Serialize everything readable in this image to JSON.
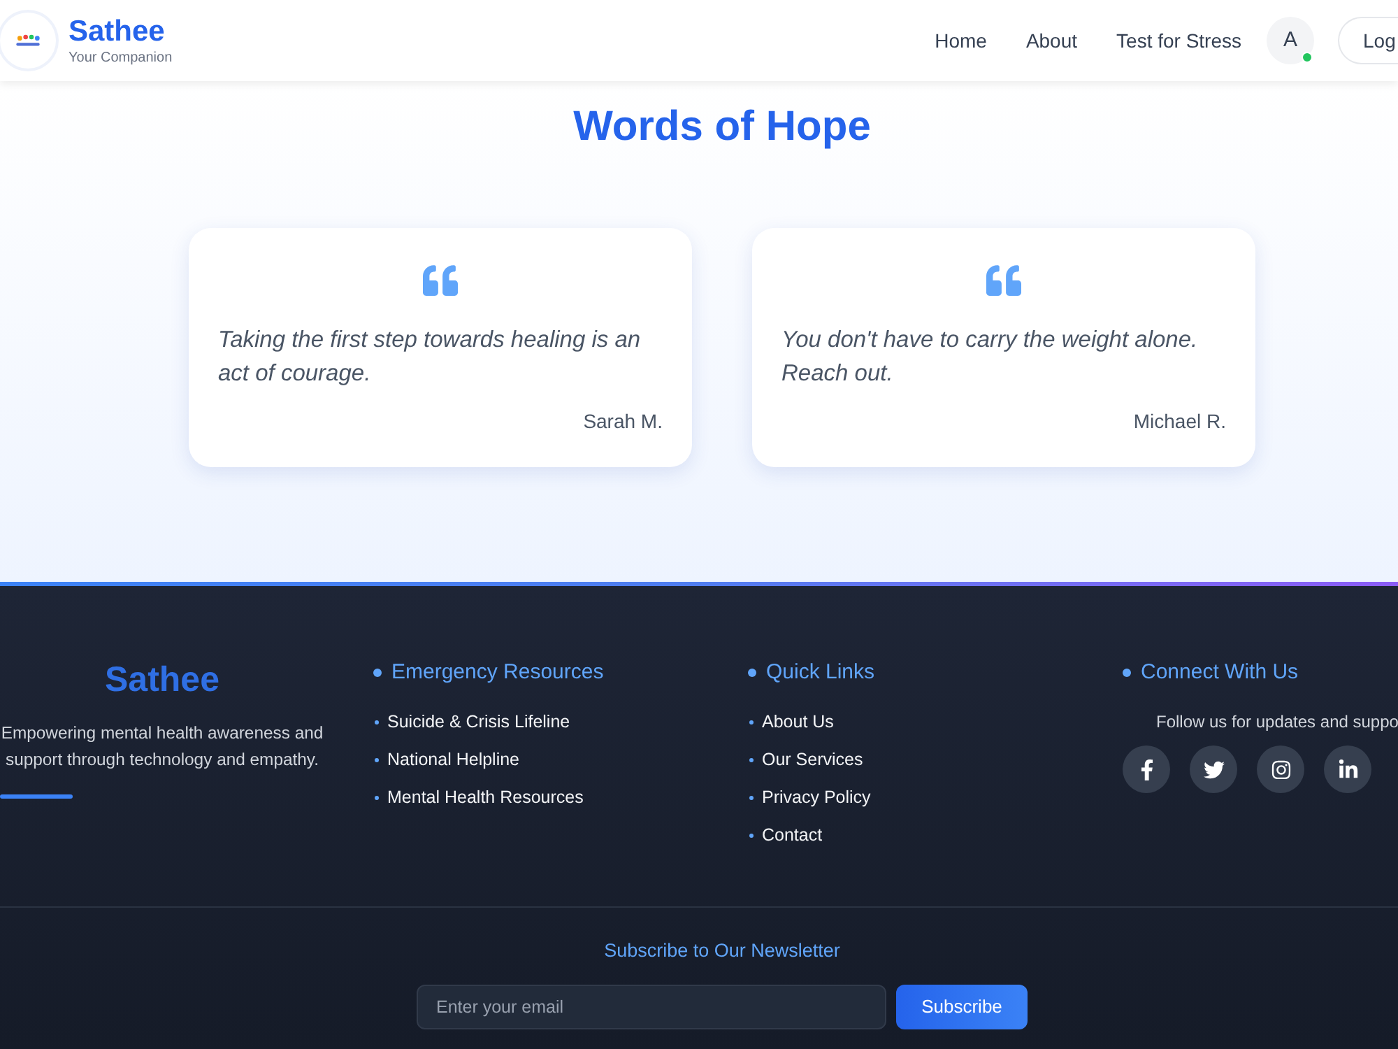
{
  "header": {
    "brand": {
      "name": "Sathee",
      "tagline": "Your Companion"
    },
    "nav": [
      {
        "label": "Home"
      },
      {
        "label": "About"
      },
      {
        "label": "Test for Stress"
      }
    ],
    "avatar": {
      "initial": "A",
      "online": true
    },
    "logout_button": "Log"
  },
  "testimonials": {
    "title": "Words of Hope",
    "cards": [
      {
        "quote": "Taking the first step towards healing is an act of courage.",
        "author": "Sarah M."
      },
      {
        "quote": "You don't have to carry the weight alone. Reach out.",
        "author": "Michael R."
      }
    ]
  },
  "footer": {
    "brand": {
      "name": "Sathee",
      "description": "Empowering mental health awareness and support through technology and empathy."
    },
    "columns": [
      {
        "title": "Emergency Resources",
        "links": [
          "Suicide & Crisis Lifeline",
          "National Helpline",
          "Mental Health Resources"
        ]
      },
      {
        "title": "Quick Links",
        "links": [
          "About Us",
          "Our Services",
          "Privacy Policy",
          "Contact"
        ]
      }
    ],
    "connect": {
      "title": "Connect With Us",
      "text": "Follow us for updates and suppo",
      "socials": [
        {
          "kind": "facebook"
        },
        {
          "kind": "twitter"
        },
        {
          "kind": "instagram"
        },
        {
          "kind": "linkedin"
        }
      ]
    },
    "newsletter": {
      "title": "Subscribe to Our Newsletter",
      "placeholder": "Enter your email",
      "button": "Subscribe"
    }
  }
}
